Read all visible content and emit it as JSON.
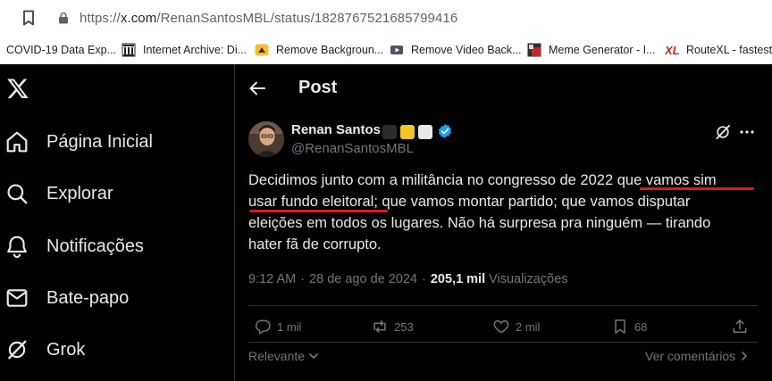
{
  "browser": {
    "url_prefix": "https://",
    "url_host": "x.com",
    "url_path": "/RenanSantosMBL/status/1828767521685799416",
    "bookmarks": [
      {
        "label": "COVID-19 Data Exp...",
        "icon": "covid-data-icon"
      },
      {
        "label": "Internet Archive: Di...",
        "icon": "internet-archive-icon"
      },
      {
        "label": "Remove Backgroun...",
        "icon": "remove-bg-icon"
      },
      {
        "label": "Remove Video Back...",
        "icon": "remove-video-bg-icon"
      },
      {
        "label": "Meme Generator - I...",
        "icon": "meme-generator-icon"
      },
      {
        "label": "RouteXL - fastest r",
        "icon": "routexl-icon"
      }
    ]
  },
  "nav": {
    "items": [
      {
        "label": "Página Inicial",
        "icon": "home-icon"
      },
      {
        "label": "Explorar",
        "icon": "search-icon"
      },
      {
        "label": "Notificações",
        "icon": "bell-icon"
      },
      {
        "label": "Bate-papo",
        "icon": "mail-icon"
      },
      {
        "label": "Grok",
        "icon": "grok-icon"
      }
    ]
  },
  "header": {
    "title": "Post"
  },
  "tweet": {
    "author_name": "Renan Santos",
    "handle": "@RenanSantosMBL",
    "lines": [
      "Decidimos junto com a militância no congresso de 2022 que vamos sim",
      "usar fundo eleitoral; que vamos montar partido; que vamos disputar",
      "eleições em todos os lugares. Não há surpresa pra ninguém — tirando",
      "hater fã de corrupto."
    ],
    "time": "9:12 AM",
    "date": "28 de ago de 2024",
    "views_count": "205,1 mil",
    "views_label": "Visualizações",
    "replies": "1 mil",
    "reposts": "253",
    "likes": "2 mil",
    "bookmarks_count": "68",
    "sort_label": "Relevante",
    "comments_link": "Ver comentários",
    "colors": {
      "verified": "#1d9bf0",
      "underline": "#e8141b",
      "flag_black": "#2b2b2b",
      "flag_yellow": "#f3c623",
      "flag_white": "#e9e9e9"
    }
  }
}
